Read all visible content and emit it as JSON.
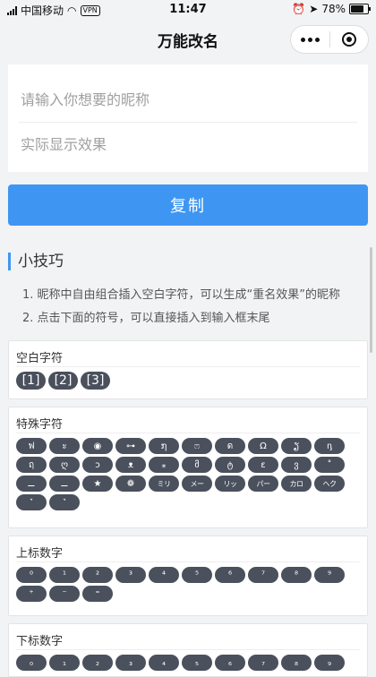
{
  "status": {
    "carrier": "中国移动",
    "vpn": "VPN",
    "time": "11:47",
    "battery": "78%",
    "battery_level": 0.78
  },
  "nav": {
    "title": "万能改名"
  },
  "inputs": {
    "nickname_placeholder": "请输入你想要的昵称",
    "preview_placeholder": "实际显示效果"
  },
  "copy_button": "复制",
  "tips": {
    "title": "小技巧",
    "items": [
      "1. 昵称中自由组合插入空白字符，可以生成“重名效果”的昵称",
      "2. 点击下面的符号，可以直接插入到输入框末尾"
    ]
  },
  "sections": {
    "blank": {
      "title": "空白字符",
      "chips": [
        "[1]",
        "[2]",
        "[3]"
      ]
    },
    "special": {
      "title": "特殊字符",
      "chips": [
        "ฟ",
        "ะ",
        "◉",
        "⊶",
        "໗",
        "ෆ",
        "ด",
        "Ω",
        "ຽ",
        "ᶇ",
        "ฤ",
        "ღ",
        "ↄ",
        "ᴥ",
        "⁎",
        "მ",
        "ტ",
        "ɛ",
        "ვ",
        "˚",
        "⚊",
        "⚊",
        "★",
        "❁",
        "ミリ",
        "メー",
        "リッ",
        "パー",
        "カロ",
        "ヘク",
        "ꙿ",
        "ꙿ"
      ]
    },
    "superscript": {
      "title": "上标数字",
      "chips": [
        "⁰",
        "¹",
        "²",
        "³",
        "⁴",
        "⁵",
        "⁶",
        "⁷",
        "⁸",
        "⁹",
        "⁺",
        "⁻",
        "⁼"
      ]
    },
    "subscript": {
      "title": "下标数字",
      "chips": [
        "₀",
        "₁",
        "₂",
        "₃",
        "₄",
        "₅",
        "₆",
        "₇",
        "₈",
        "₉"
      ]
    }
  },
  "colors": {
    "accent": "#3e96f2",
    "chip": "#4a505c"
  }
}
